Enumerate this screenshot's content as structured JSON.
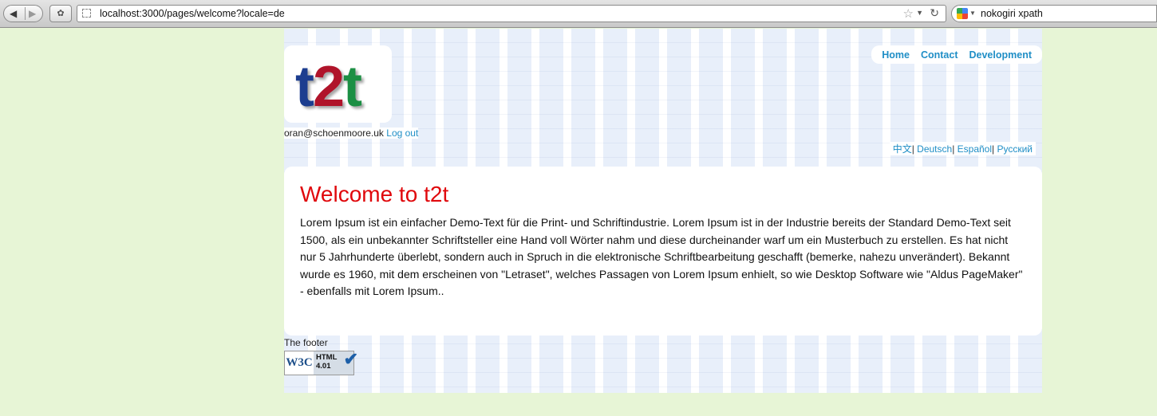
{
  "browser": {
    "back_icon": "◀",
    "forward_icon": "▶",
    "url": "localhost:3000/pages/welcome?locale=de",
    "search_query": "nokogiri xpath"
  },
  "header": {
    "logo": {
      "t1": "t",
      "two": "2",
      "t2": "t",
      "colors": {
        "t1": "#1c3d8f",
        "two": "#b0142a",
        "t2": "#1c8f44"
      }
    },
    "nav": [
      "Home",
      "Contact",
      "Development"
    ],
    "user_email": "oran@schoenmoore.uk",
    "logout_label": "Log out",
    "languages": [
      "中文",
      "Deutsch",
      "Español",
      "Русский"
    ]
  },
  "main": {
    "title": "Welcome to t2t",
    "body": "Lorem Ipsum ist ein einfacher Demo-Text für die Print- und Schriftindustrie. Lorem Ipsum ist in der Industrie bereits der Standard Demo-Text seit 1500, als ein unbekannter Schriftsteller eine Hand voll Wörter nahm und diese durcheinander warf um ein Musterbuch zu erstellen. Es hat nicht nur 5 Jahrhunderte überlebt, sondern auch in Spruch in die elektronische Schriftbearbeitung geschafft (bemerke, nahezu unverändert). Bekannt wurde es 1960, mit dem erscheinen von \"Letraset\", welches Passagen von Lorem Ipsum enhielt, so wie Desktop Software wie \"Aldus PageMaker\" - ebenfalls mit Lorem Ipsum.."
  },
  "footer": {
    "text": "The footer",
    "badge": {
      "w3c": "W3C",
      "line1": "HTML",
      "line2": "4.01"
    }
  },
  "colors": {
    "accent": "#1f8ec6",
    "title": "#e0080c",
    "page_bg": "#e7f5d6"
  }
}
